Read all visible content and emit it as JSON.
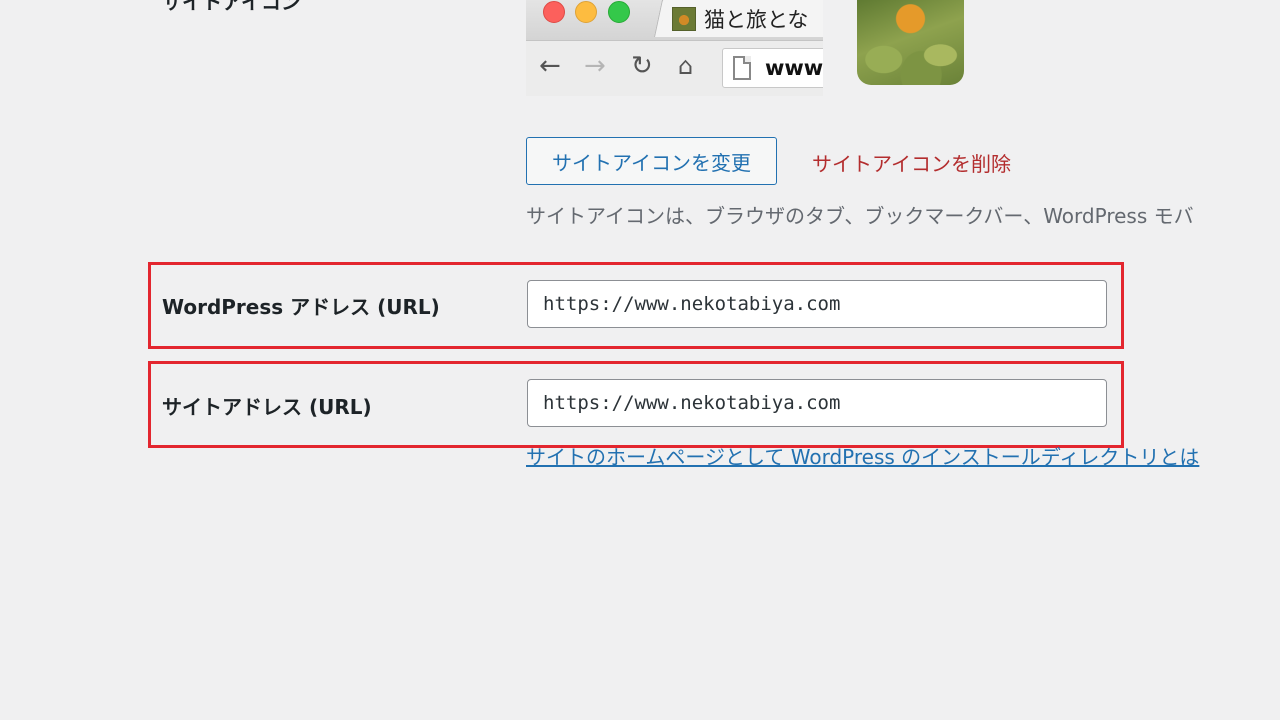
{
  "site_icon_section": {
    "heading": "サイトアイコン",
    "browser_preview": {
      "tab_title": "猫と旅とな",
      "address_text": "www.",
      "icons": [
        "back-arrow-icon",
        "forward-arrow-icon",
        "reload-icon",
        "home-icon",
        "page-icon",
        "favicon-icon"
      ]
    },
    "change_button_label": "サイトアイコンを変更",
    "remove_link_label": "サイトアイコンを削除",
    "description": "サイトアイコンは、ブラウザのタブ、ブックマークバー、WordPress モバ"
  },
  "wordpress_address": {
    "label": "WordPress アドレス (URL)",
    "value": "https://www.nekotabiya.com"
  },
  "site_address": {
    "label": "サイトアドレス (URL)",
    "value": "https://www.nekotabiya.com",
    "help_link": "サイトのホームページとして WordPress のインストールディレクトリとは"
  },
  "colors": {
    "highlight": "#e3262f",
    "link": "#2271b1",
    "delete": "#b32d2e",
    "background": "#f0f0f1"
  }
}
